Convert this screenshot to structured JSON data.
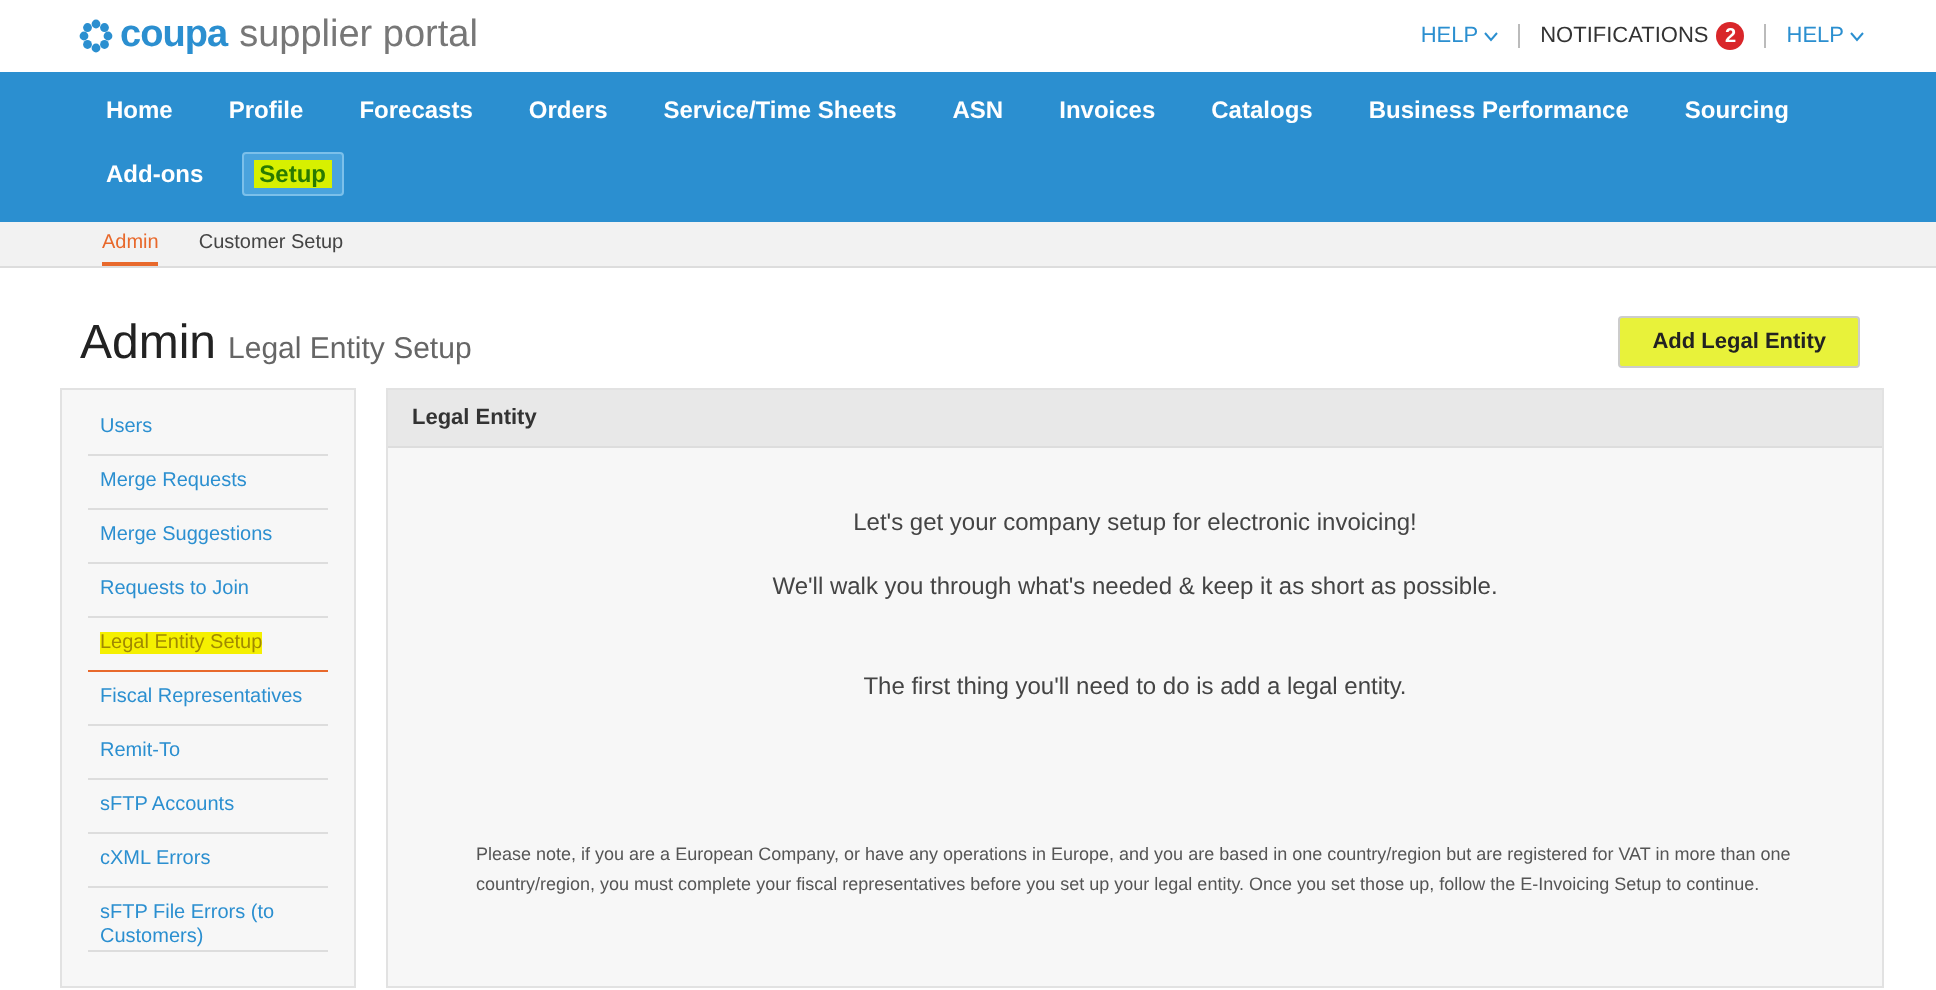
{
  "logo": {
    "brand": "coupa",
    "product": "supplier portal"
  },
  "top_links": [
    {
      "kind": "menu",
      "label": "HELP"
    },
    {
      "kind": "badge",
      "label": "NOTIFICATIONS",
      "count": "2"
    },
    {
      "kind": "menu",
      "label": "HELP"
    }
  ],
  "nav": [
    {
      "label": "Home",
      "selected": false,
      "highlighted": false
    },
    {
      "label": "Profile",
      "selected": false,
      "highlighted": false
    },
    {
      "label": "Forecasts",
      "selected": false,
      "highlighted": false
    },
    {
      "label": "Orders",
      "selected": false,
      "highlighted": false
    },
    {
      "label": "Service/Time Sheets",
      "selected": false,
      "highlighted": false
    },
    {
      "label": "ASN",
      "selected": false,
      "highlighted": false
    },
    {
      "label": "Invoices",
      "selected": false,
      "highlighted": false
    },
    {
      "label": "Catalogs",
      "selected": false,
      "highlighted": false
    },
    {
      "label": "Business Performance",
      "selected": false,
      "highlighted": false
    },
    {
      "label": "Sourcing",
      "selected": false,
      "highlighted": false
    },
    {
      "label": "Add-ons",
      "selected": false,
      "highlighted": false
    },
    {
      "label": "Setup",
      "selected": true,
      "highlighted": true
    }
  ],
  "subnav": [
    {
      "label": "Admin",
      "selected": true
    },
    {
      "label": "Customer Setup",
      "selected": false
    }
  ],
  "page_title": {
    "title": "Admin",
    "subtitle": "Legal Entity Setup"
  },
  "add_button": {
    "label": "Add Legal Entity",
    "highlighted": true
  },
  "sidebar": [
    {
      "label": "Users",
      "selected": false,
      "highlighted": false
    },
    {
      "label": "Merge Requests",
      "selected": false,
      "highlighted": false
    },
    {
      "label": "Merge Suggestions",
      "selected": false,
      "highlighted": false
    },
    {
      "label": "Requests to Join",
      "selected": false,
      "highlighted": false
    },
    {
      "label": "Legal Entity Setup",
      "selected": true,
      "highlighted": true
    },
    {
      "label": "Fiscal Representatives",
      "selected": false,
      "highlighted": false
    },
    {
      "label": "Remit-To",
      "selected": false,
      "highlighted": false
    },
    {
      "label": "sFTP Accounts",
      "selected": false,
      "highlighted": false
    },
    {
      "label": "cXML Errors",
      "selected": false,
      "highlighted": false
    },
    {
      "label": "sFTP File Errors (to Customers)",
      "selected": false,
      "highlighted": false
    }
  ],
  "panel": {
    "title": "Legal Entity",
    "intro": [
      "Let's get your company setup for electronic invoicing!",
      "We'll walk you through what's needed & keep it as short as possible."
    ],
    "first_step": "The first thing you'll need to do is add a legal entity.",
    "note": "Please note, if you are a European Company, or have any operations in Europe, and you are based in one country/region but are registered for VAT in more than one country/region, you must complete your fiscal representatives before you set up your legal entity. Once you set those up, follow the E-Invoicing Setup to continue."
  }
}
